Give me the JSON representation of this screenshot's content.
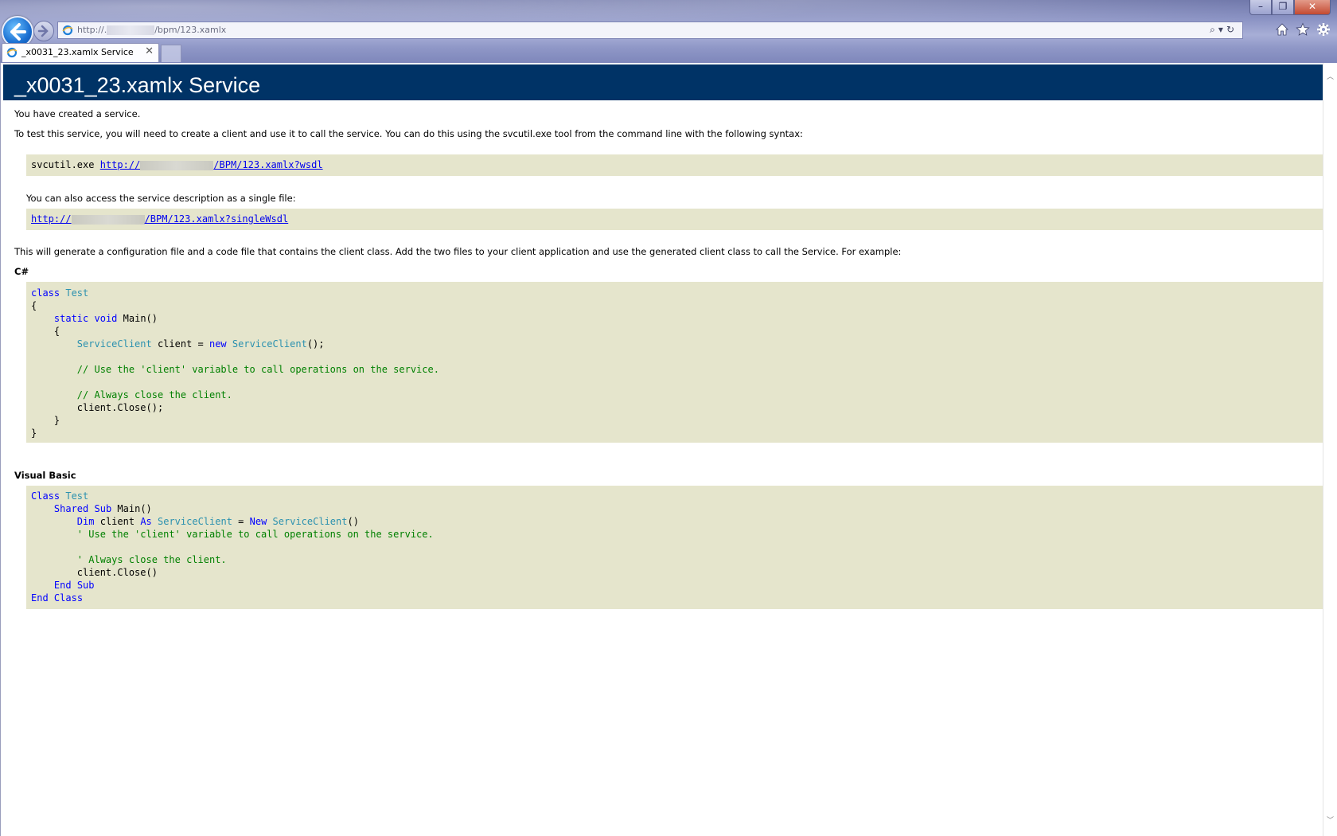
{
  "browser": {
    "address_prefix": "http://.",
    "address_suffix": "/bpm/123.xamlx",
    "tab_title": "_x0031_23.xamlx Service",
    "tab_close": "✕",
    "window_buttons": {
      "minimize": "–",
      "restore": "❐",
      "close": "✕"
    }
  },
  "page": {
    "title": "_x0031_23.xamlx Service",
    "intro": "You have created a service.",
    "instructions": "To test this service, you will need to create a client and use it to call the service. You can do this using the svcutil.exe tool from the command line with the following syntax:",
    "svcutil_cmd": "svcutil.exe",
    "wsdl_prefix": "http://",
    "wsdl_suffix": "/BPM/123.xamlx?wsdl",
    "single_file_text": "You can also access the service description as a single file:",
    "single_prefix": "http://",
    "single_suffix": "/BPM/123.xamlx?singleWsdl",
    "generate_text": "This will generate a configuration file and a code file that contains the client class. Add the two files to your client application and use the generated client class to call the Service. For example:",
    "csharp_heading": "C#",
    "vb_heading": "Visual Basic"
  },
  "code": {
    "cs": {
      "l1_kw": "class",
      "l1_ty": "Test",
      "l2": "{",
      "l3_kw1": "static",
      "l3_kw2": "void",
      "l3_rest": "Main()",
      "l4": "{",
      "l5_ty1": "ServiceClient",
      "l5_mid": "client =",
      "l5_kw": "new",
      "l5_ty2": "ServiceClient",
      "l5_end": "();",
      "l7_cm": "// Use the 'client' variable to call operations on the service.",
      "l9_cm": "// Always close the client.",
      "l10": "client.Close();",
      "l11": "}",
      "l12": "}"
    },
    "vb": {
      "l1_kw": "Class",
      "l1_ty": "Test",
      "l2_kw1": "Shared",
      "l2_kw2": "Sub",
      "l2_rest": "Main()",
      "l3_kw1": "Dim",
      "l3_mid": "client",
      "l3_kw2": "As",
      "l3_ty1": "ServiceClient",
      "l3_eq": "=",
      "l3_kw3": "New",
      "l3_ty2": "ServiceClient",
      "l3_end": "()",
      "l4_cm": "' Use the 'client' variable to call operations on the service.",
      "l6_cm": "' Always close the client.",
      "l7": "client.Close()",
      "l8_kw1": "End",
      "l8_kw2": "Sub",
      "l9_kw1": "End",
      "l9_kw2": "Class"
    }
  },
  "colors": {
    "header_bg": "#003366",
    "code_bg": "#e5e5cc",
    "keyword": "#0000ff",
    "type": "#2b91af",
    "comment": "#008000"
  }
}
